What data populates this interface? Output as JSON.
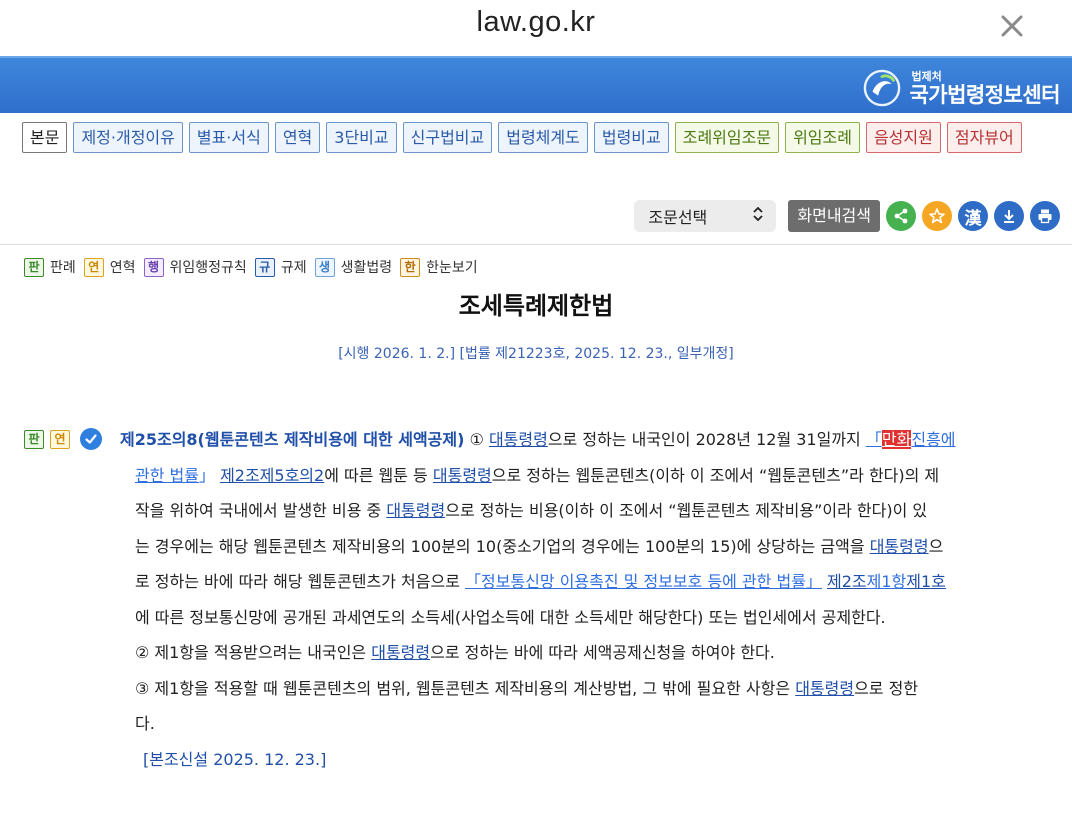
{
  "browser": {
    "url": "law.go.kr"
  },
  "header": {
    "logo_small": "법제처",
    "logo_big": "국가법령정보센터"
  },
  "tabs": [
    {
      "label": "본문",
      "style": "active"
    },
    {
      "label": "제정·개정이유",
      "style": "blue"
    },
    {
      "label": "별표·서식",
      "style": "blue"
    },
    {
      "label": "연혁",
      "style": "blue"
    },
    {
      "label": "3단비교",
      "style": "blue"
    },
    {
      "label": "신구법비교",
      "style": "blue"
    },
    {
      "label": "법령체계도",
      "style": "blue"
    },
    {
      "label": "법령비교",
      "style": "blue"
    },
    {
      "label": "조례위임조문",
      "style": "green"
    },
    {
      "label": "위임조례",
      "style": "green"
    },
    {
      "label": "음성지원",
      "style": "red"
    },
    {
      "label": "점자뷰어",
      "style": "red"
    }
  ],
  "controls": {
    "select_label": "조문선택",
    "search_button": "화면내검색",
    "han_icon": "漢"
  },
  "legend": [
    {
      "badge": "판",
      "label": "판례"
    },
    {
      "badge": "연",
      "label": "연혁"
    },
    {
      "badge": "행",
      "label": "위임행정규칙"
    },
    {
      "badge": "규",
      "label": "규제"
    },
    {
      "badge": "생",
      "label": "생활법령"
    },
    {
      "badge": "한",
      "label": "한눈보기"
    }
  ],
  "law": {
    "title": "조세특례제한법",
    "subtitle": "[시행 2026. 1. 2.] [법률 제21223호, 2025. 12. 23., 일부개정]"
  },
  "article": {
    "badges": [
      "판",
      "연"
    ],
    "heading": "제25조의8(웹툰콘텐츠 제작비용에 대한 세액공제)",
    "p1_a": " ① ",
    "link_decree": "대통령령",
    "p1_b": "으로 정하는 내국인이 2028년 12월 31일까지 ",
    "q_open": "「",
    "hl_word": "만화",
    "law_link_1": "진흥에",
    "law_link_2": "관한 법률",
    "q_close": "」 ",
    "ref_1": "제2조제5호의2",
    "p1_c": "에 따른 웹툰 등 ",
    "p1_d": "으로 정하는 웹툰콘텐츠(이하 이 조에서 “웹툰콘텐츠”라 한다)의 제",
    "p1_e": "작을 위하여 국내에서 발생한 비용 중 ",
    "p1_f": "으로 정하는 비용(이하 이 조에서 “웹툰콘텐츠 제작비용”이라 한다)이 있",
    "p1_g": "는 경우에는 해당 웹툰콘텐츠 제작비용의 100분의 10(중소기업의 경우에는 100분의 15)에 상당하는 금액을 ",
    "p1_h": "으",
    "p1_i": "로 정하는 바에 따라 해당 웹툰콘텐츠가 처음으로 ",
    "law_link_3": "「정보통신망 이용촉진 및 정보보호 등에 관한 법률」",
    "ref_2a": "제2조",
    "ref_2b": "제1항",
    "ref_2c": "제1호",
    "p1_j": "에 따른 정보통신망에 공개된 과세연도의 소득세(사업소득에 대한 소득세만 해당한다) 또는 법인세에서 공제한다.",
    "p2_a": "② 제1항을 적용받으려는 내국인은 ",
    "p2_b": "으로 정하는 바에 따라 세액공제신청을 하여야 한다.",
    "p3_a": "③ 제1항을 적용할 때 웹툰콘텐츠의 범위, 웹툰콘텐츠 제작비용의 계산방법, 그 밖에 필요한 사항은 ",
    "p3_b": "으로 정한",
    "p3_c": "다.",
    "footnote": "[본조신설 2025. 12. 23.]"
  }
}
